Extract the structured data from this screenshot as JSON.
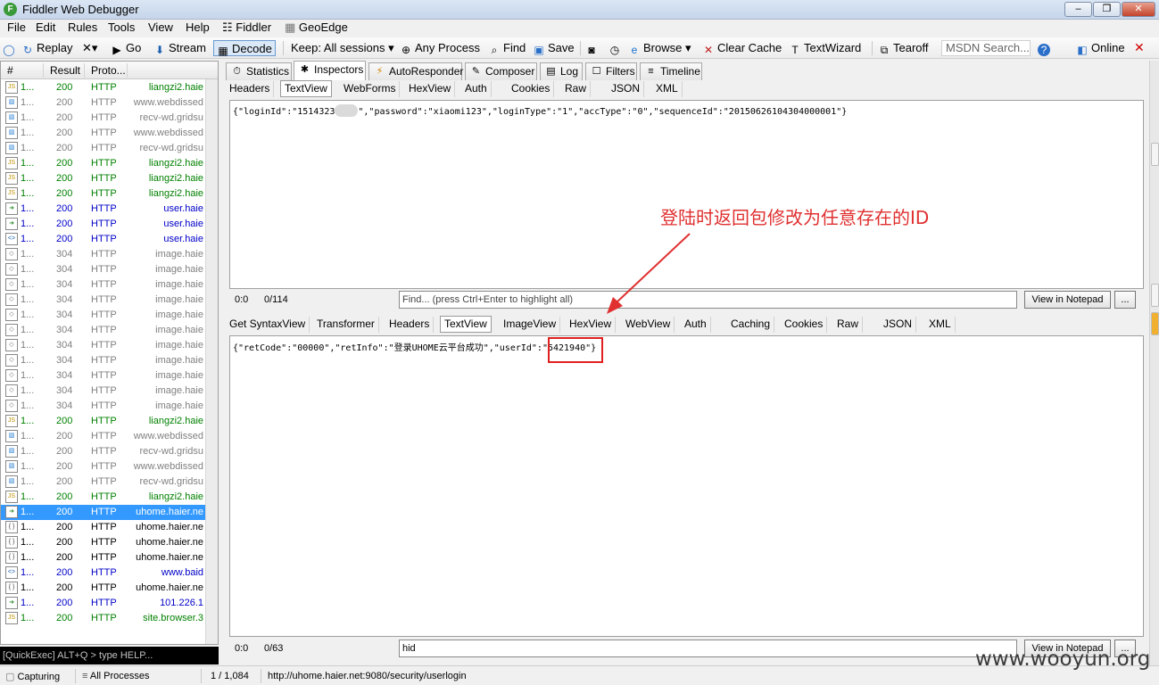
{
  "window": {
    "title": "Fiddler Web Debugger",
    "buttons": {
      "minimize": "–",
      "restore": "❐",
      "close": "✕"
    }
  },
  "menu": [
    "File",
    "Edit",
    "Rules",
    "Tools",
    "View",
    "Help",
    "Fiddler",
    "GeoEdge"
  ],
  "toolbar": {
    "replay": "Replay",
    "remove": "✕▾",
    "go": "Go",
    "stream": "Stream",
    "decode": "Decode",
    "keep": "Keep: All sessions",
    "process": "Any Process",
    "find": "Find",
    "save": "Save",
    "browse": "Browse",
    "clear_cache": "Clear Cache",
    "textwizard": "TextWizard",
    "tearoff": "Tearoff",
    "msdn_placeholder": "MSDN Search...",
    "online": "Online",
    "close": "✕"
  },
  "sessions": {
    "headers": [
      "#",
      "Result",
      "Proto...",
      "Host"
    ],
    "rows": [
      {
        "num": "1...",
        "result": "200",
        "protocol": "HTTP",
        "host": "liangzi2.haie",
        "color": "green",
        "icon": "js"
      },
      {
        "num": "1...",
        "result": "200",
        "protocol": "HTTP",
        "host": "www.webdissed",
        "color": "gray",
        "icon": "img"
      },
      {
        "num": "1...",
        "result": "200",
        "protocol": "HTTP",
        "host": "recv-wd.gridsu",
        "color": "gray",
        "icon": "img"
      },
      {
        "num": "1...",
        "result": "200",
        "protocol": "HTTP",
        "host": "www.webdissed",
        "color": "gray",
        "icon": "img"
      },
      {
        "num": "1...",
        "result": "200",
        "protocol": "HTTP",
        "host": "recv-wd.gridsu",
        "color": "gray",
        "icon": "img"
      },
      {
        "num": "1...",
        "result": "200",
        "protocol": "HTTP",
        "host": "liangzi2.haie",
        "color": "green",
        "icon": "js"
      },
      {
        "num": "1...",
        "result": "200",
        "protocol": "HTTP",
        "host": "liangzi2.haie",
        "color": "green",
        "icon": "js"
      },
      {
        "num": "1...",
        "result": "200",
        "protocol": "HTTP",
        "host": "liangzi2.haie",
        "color": "green",
        "icon": "js"
      },
      {
        "num": "1...",
        "result": "200",
        "protocol": "HTTP",
        "host": "user.haie",
        "color": "blue",
        "icon": "arrow"
      },
      {
        "num": "1...",
        "result": "200",
        "protocol": "HTTP",
        "host": "user.haie",
        "color": "blue",
        "icon": "arrow"
      },
      {
        "num": "1...",
        "result": "200",
        "protocol": "HTTP",
        "host": "user.haie",
        "color": "blue",
        "icon": "code"
      },
      {
        "num": "1...",
        "result": "304",
        "protocol": "HTTP",
        "host": "image.haie",
        "color": "gray",
        "icon": "diamond"
      },
      {
        "num": "1...",
        "result": "304",
        "protocol": "HTTP",
        "host": "image.haie",
        "color": "gray",
        "icon": "diamond"
      },
      {
        "num": "1...",
        "result": "304",
        "protocol": "HTTP",
        "host": "image.haie",
        "color": "gray",
        "icon": "diamond"
      },
      {
        "num": "1...",
        "result": "304",
        "protocol": "HTTP",
        "host": "image.haie",
        "color": "gray",
        "icon": "diamond"
      },
      {
        "num": "1...",
        "result": "304",
        "protocol": "HTTP",
        "host": "image.haie",
        "color": "gray",
        "icon": "diamond"
      },
      {
        "num": "1...",
        "result": "304",
        "protocol": "HTTP",
        "host": "image.haie",
        "color": "gray",
        "icon": "diamond"
      },
      {
        "num": "1...",
        "result": "304",
        "protocol": "HTTP",
        "host": "image.haie",
        "color": "gray",
        "icon": "diamond"
      },
      {
        "num": "1...",
        "result": "304",
        "protocol": "HTTP",
        "host": "image.haie",
        "color": "gray",
        "icon": "diamond"
      },
      {
        "num": "1...",
        "result": "304",
        "protocol": "HTTP",
        "host": "image.haie",
        "color": "gray",
        "icon": "diamond"
      },
      {
        "num": "1...",
        "result": "304",
        "protocol": "HTTP",
        "host": "image.haie",
        "color": "gray",
        "icon": "diamond"
      },
      {
        "num": "1...",
        "result": "304",
        "protocol": "HTTP",
        "host": "image.haie",
        "color": "gray",
        "icon": "diamond"
      },
      {
        "num": "1...",
        "result": "200",
        "protocol": "HTTP",
        "host": "liangzi2.haie",
        "color": "green",
        "icon": "js"
      },
      {
        "num": "1...",
        "result": "200",
        "protocol": "HTTP",
        "host": "www.webdissed",
        "color": "gray",
        "icon": "img"
      },
      {
        "num": "1...",
        "result": "200",
        "protocol": "HTTP",
        "host": "recv-wd.gridsu",
        "color": "gray",
        "icon": "img"
      },
      {
        "num": "1...",
        "result": "200",
        "protocol": "HTTP",
        "host": "www.webdissed",
        "color": "gray",
        "icon": "img"
      },
      {
        "num": "1...",
        "result": "200",
        "protocol": "HTTP",
        "host": "recv-wd.gridsu",
        "color": "gray",
        "icon": "img"
      },
      {
        "num": "1...",
        "result": "200",
        "protocol": "HTTP",
        "host": "liangzi2.haie",
        "color": "green",
        "icon": "js"
      },
      {
        "num": "1...",
        "result": "200",
        "protocol": "HTTP",
        "host": "uhome.haier.ne",
        "color": "sel",
        "icon": "arrow"
      },
      {
        "num": "1...",
        "result": "200",
        "protocol": "HTTP",
        "host": "uhome.haier.ne",
        "color": "black",
        "icon": "json"
      },
      {
        "num": "1...",
        "result": "200",
        "protocol": "HTTP",
        "host": "uhome.haier.ne",
        "color": "black",
        "icon": "json"
      },
      {
        "num": "1...",
        "result": "200",
        "protocol": "HTTP",
        "host": "uhome.haier.ne",
        "color": "black",
        "icon": "json"
      },
      {
        "num": "1...",
        "result": "200",
        "protocol": "HTTP",
        "host": "www.baid",
        "color": "blue",
        "icon": "code"
      },
      {
        "num": "1...",
        "result": "200",
        "protocol": "HTTP",
        "host": "uhome.haier.ne",
        "color": "black",
        "icon": "json"
      },
      {
        "num": "1...",
        "result": "200",
        "protocol": "HTTP",
        "host": "101.226.1",
        "color": "blue",
        "icon": "arrow"
      },
      {
        "num": "1...",
        "result": "200",
        "protocol": "HTTP",
        "host": "site.browser.3",
        "color": "green",
        "icon": "js"
      }
    ]
  },
  "quickexec": "[QuickExec] ALT+Q > type HELP...",
  "statusbar": {
    "capturing": "Capturing",
    "processes": "All Processes",
    "count": "1 / 1,084",
    "url": "http://uhome.haier.net:9080/security/userlogin"
  },
  "main_tabs": [
    {
      "label": "Statistics",
      "icon": "⏱"
    },
    {
      "label": "Inspectors",
      "icon": "✱"
    },
    {
      "label": "AutoResponder",
      "icon": "⚡"
    },
    {
      "label": "Composer",
      "icon": "✎"
    },
    {
      "label": "Log",
      "icon": "▤"
    },
    {
      "label": "Filters",
      "icon": "☐"
    },
    {
      "label": "Timeline",
      "icon": "≡"
    }
  ],
  "request": {
    "tabs": [
      "Headers",
      "TextView",
      "WebForms",
      "HexView",
      "Auth",
      "Cookies",
      "Raw",
      "JSON",
      "XML"
    ],
    "body_before": "{\"loginId\":\"1514323",
    "body_after": "\",\"password\":\"xiaomi123\",\"loginType\":\"1\",\"accType\":\"0\",\"sequenceId\":\"20150626104304000001\"}",
    "position": "0:0",
    "length": "0/114",
    "find_placeholder": "Find... (press Ctrl+Enter to highlight all)",
    "notepad": "View in Notepad",
    "more": "..."
  },
  "response": {
    "tabs": [
      "Get SyntaxView",
      "Transformer",
      "Headers",
      "TextView",
      "ImageView",
      "HexView",
      "WebView",
      "Auth",
      "Caching",
      "Cookies",
      "Raw",
      "JSON",
      "XML"
    ],
    "body": "{\"retCode\":\"00000\",\"retInfo\":\"登录UHOME云平台成功\",\"userId\":\"5421940\"}",
    "position": "0:0",
    "length": "0/63",
    "find_value": "hid",
    "notepad": "View in Notepad",
    "more": "..."
  },
  "annotation": "登陆时返回包修改为任意存在的ID",
  "watermark": "www.wooyun.org",
  "colors": {
    "annotation": "#e03030",
    "selection": "#3399ff"
  }
}
